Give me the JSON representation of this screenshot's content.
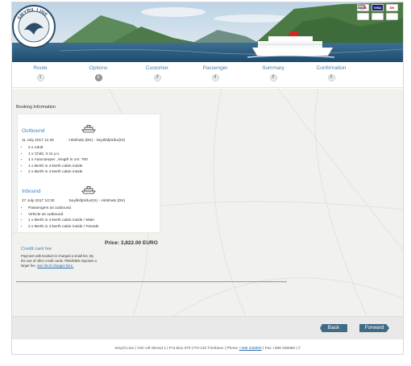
{
  "header": {
    "logo_text": "SMYRIL LINE",
    "logo_subtext": "Crossing the North Atlantic",
    "cards": [
      {
        "label": "VISA",
        "icon": "visa-card-icon"
      },
      {
        "label": "VISA",
        "icon": "visa-electron-card-icon"
      },
      {
        "label": "DK",
        "icon": "dankort-card-icon"
      },
      {
        "label": "",
        "icon": "mastercard-icon"
      },
      {
        "label": "",
        "icon": "maestro-card-icon"
      },
      {
        "label": "",
        "icon": "other-card-icon"
      }
    ]
  },
  "steps": [
    {
      "label": "Route",
      "num": "1"
    },
    {
      "label": "Options",
      "num": "2",
      "active": true
    },
    {
      "label": "Customer",
      "num": "3"
    },
    {
      "label": "Passenger",
      "num": "4"
    },
    {
      "label": "Summary",
      "num": "5"
    },
    {
      "label": "Confirmation",
      "num": "6"
    }
  ],
  "booking": {
    "section_title": "Booking Information",
    "outbound": {
      "title": "Outbound",
      "date": "11 July 2017 11:30",
      "route": "Hirtshals (DK) - Seyðisfjörður(IS)",
      "items": [
        "2 x Adult",
        "1 x Child, 3-11 y.o.",
        "1 x Autocamper , length in cm: 700",
        "1 x Berth in 4-berth cabin inside",
        "2 x Berth in 4-berth cabin inside"
      ]
    },
    "inbound": {
      "title": "Inbound",
      "date": "27 July 2017 10:30",
      "route": "Seyðisfjörður(IS) - Hirtshals (DK)",
      "items": [
        "Passengers as outbound",
        "Vehicle as outbound",
        "1 x Berth in 4-berth cabin inside / Male",
        "2 x Berth in 4-berth cabin inside / Female"
      ]
    },
    "price": "Price: 3,822.00 EURO",
    "fee": {
      "title": "Credit card fee",
      "text": "Payment with Dankort is charged a small fee. By the use of other credit cards, PBS/DIBS imposes a larger fee.",
      "link": "See list of charges here."
    }
  },
  "actions": {
    "back": "Back",
    "forward": "Forward"
  },
  "footer": {
    "text": "Smyril Line | Yviri við Strond 1 | P.O.Box 370 | FO-110 Tórshavn | Phone ",
    "phone": "+298 345900",
    "text2": " | Fax +298 345950 | ",
    "tail": "//"
  },
  "colors": {
    "accent": "#3f82c0",
    "button": "#3f6b86",
    "content_bg": "#f1f1ee"
  }
}
